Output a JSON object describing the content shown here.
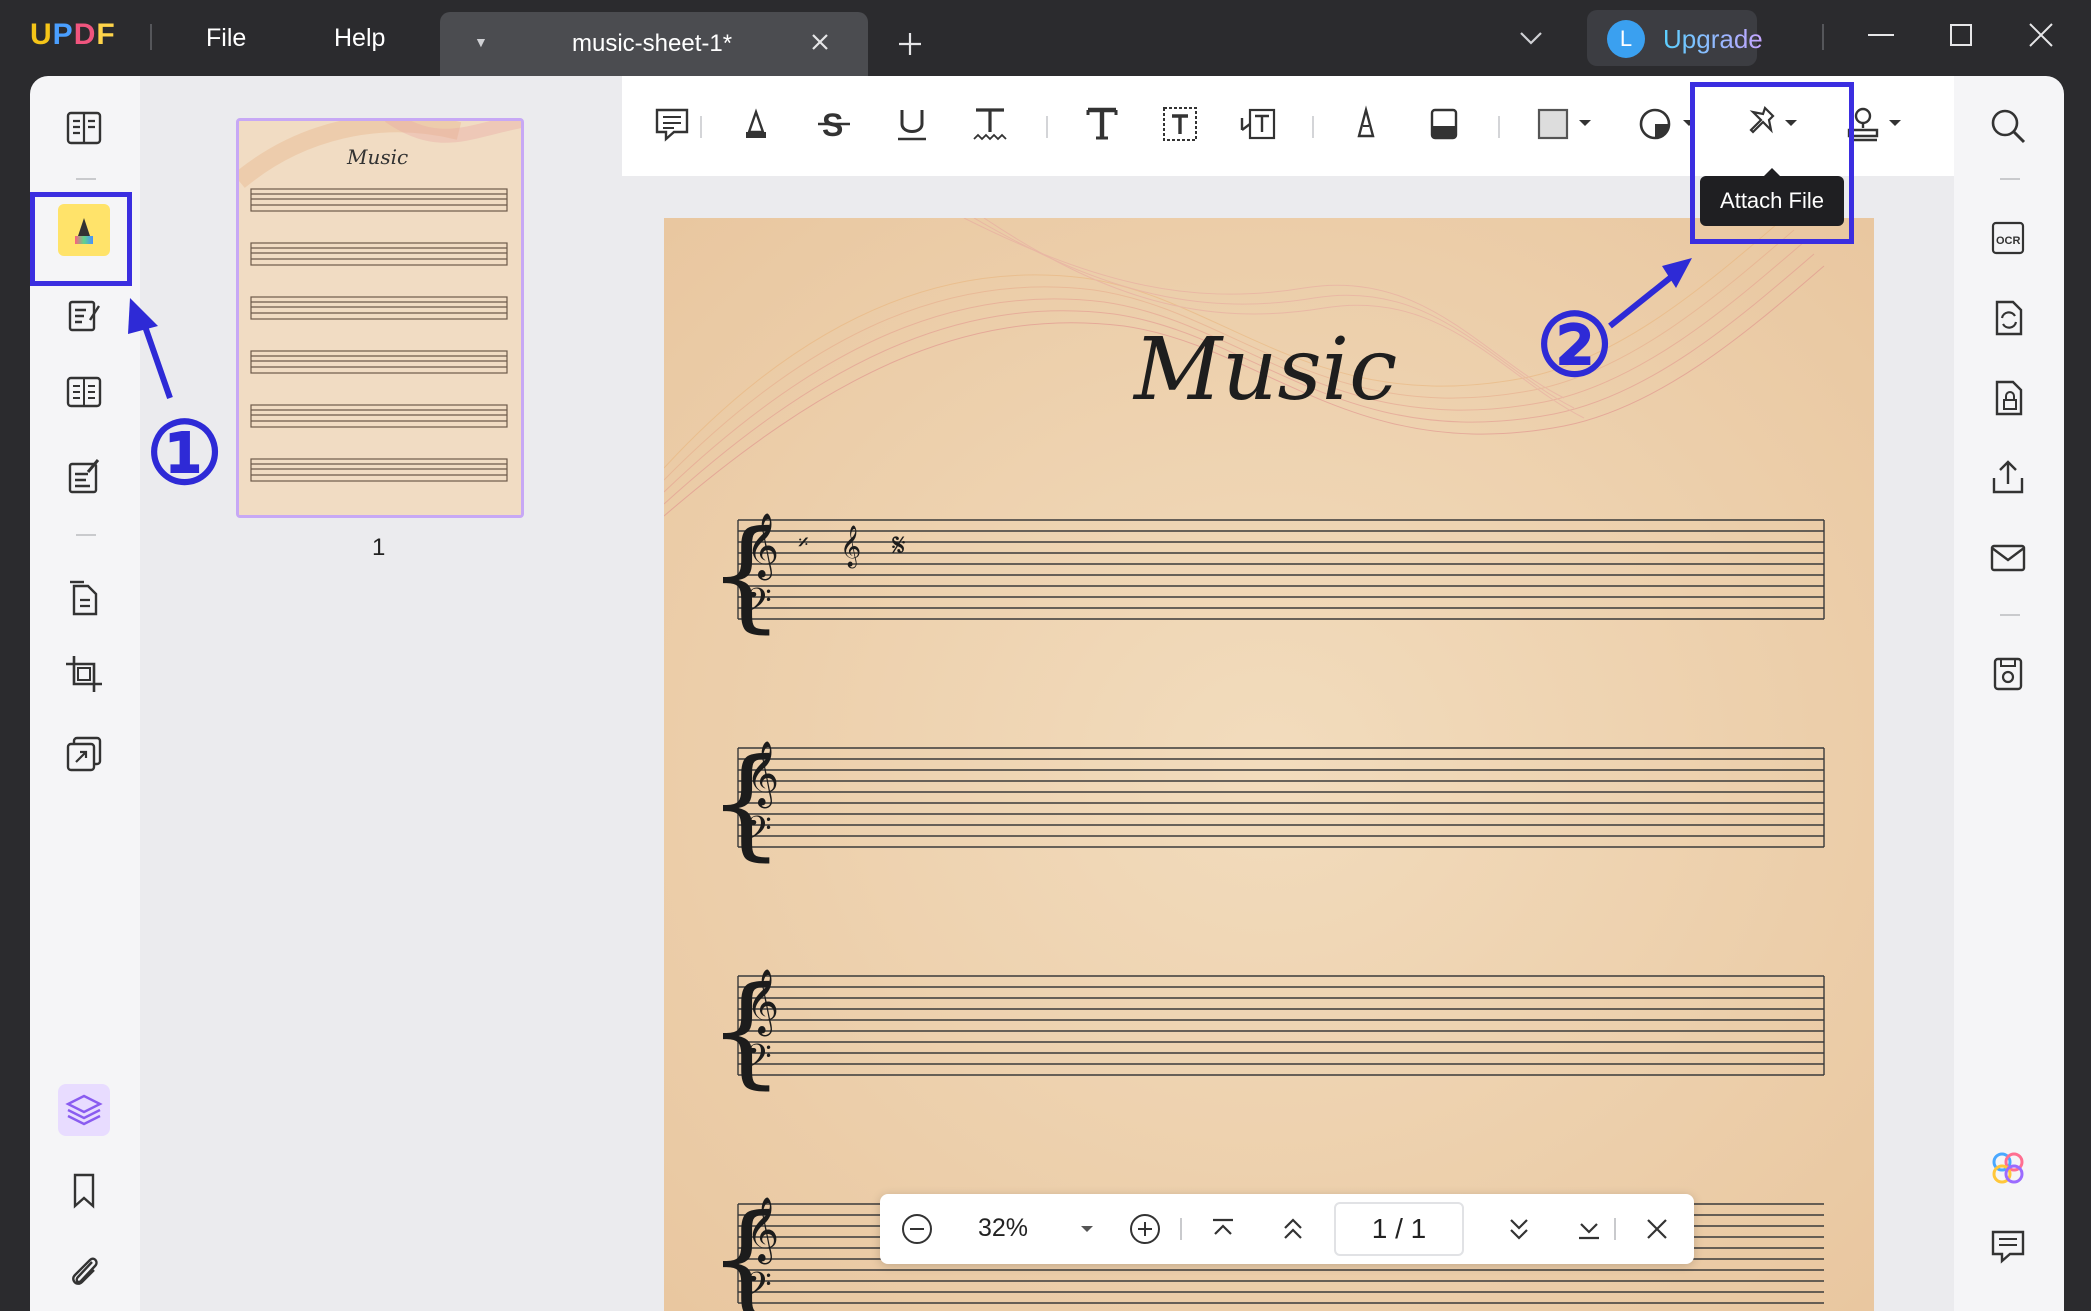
{
  "app": {
    "logo": "UPDF",
    "menu": [
      "File",
      "Help"
    ],
    "tab_title": "music-sheet-1*",
    "avatar_letter": "L",
    "upgrade_label": "Upgrade"
  },
  "toolbar": {
    "tooltip": "Attach File"
  },
  "thumbnails": {
    "page_number": "1",
    "thumb_title": "Music"
  },
  "document": {
    "title": "Music"
  },
  "zoom": {
    "value": "32%",
    "page_indicator": "1 / 1"
  },
  "annotations": {
    "step1": "①",
    "step2": "②"
  },
  "colors": {
    "highlight_box": "#3b2ee0",
    "annotation": "#2e2ad6",
    "logo_u": "#f5c518",
    "logo_p": "#4a9fff",
    "logo_d": "#f0557e",
    "logo_f": "#ffd54a"
  }
}
